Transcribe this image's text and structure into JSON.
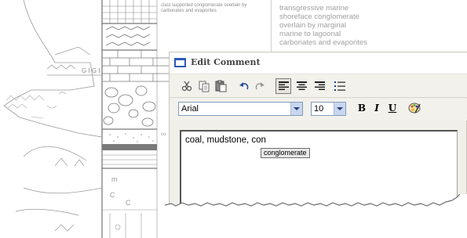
{
  "log_sheet": {
    "description_small": "clast supported conglomerate overlain by carbonates and evaporites",
    "description_right": [
      "transgressive marine",
      "shoreface conglomerate",
      "overlain by marginal",
      "marine to lagoonal",
      "carbonates and evaporites"
    ],
    "side_note": "co",
    "gypsum_label": "G I G I"
  },
  "dialog": {
    "title": "Edit Comment",
    "font_name": "Arial",
    "font_size": "10",
    "bold_label": "B",
    "italic_label": "I",
    "underline_label": "U",
    "editor_text": "coal, mudstone, con",
    "autocomplete_suggestion": "conglomerate"
  },
  "colors": {
    "title_icon": "#2d5bb8",
    "combo_button": "#c9d6ef",
    "background_text": "#a0a0a0"
  }
}
